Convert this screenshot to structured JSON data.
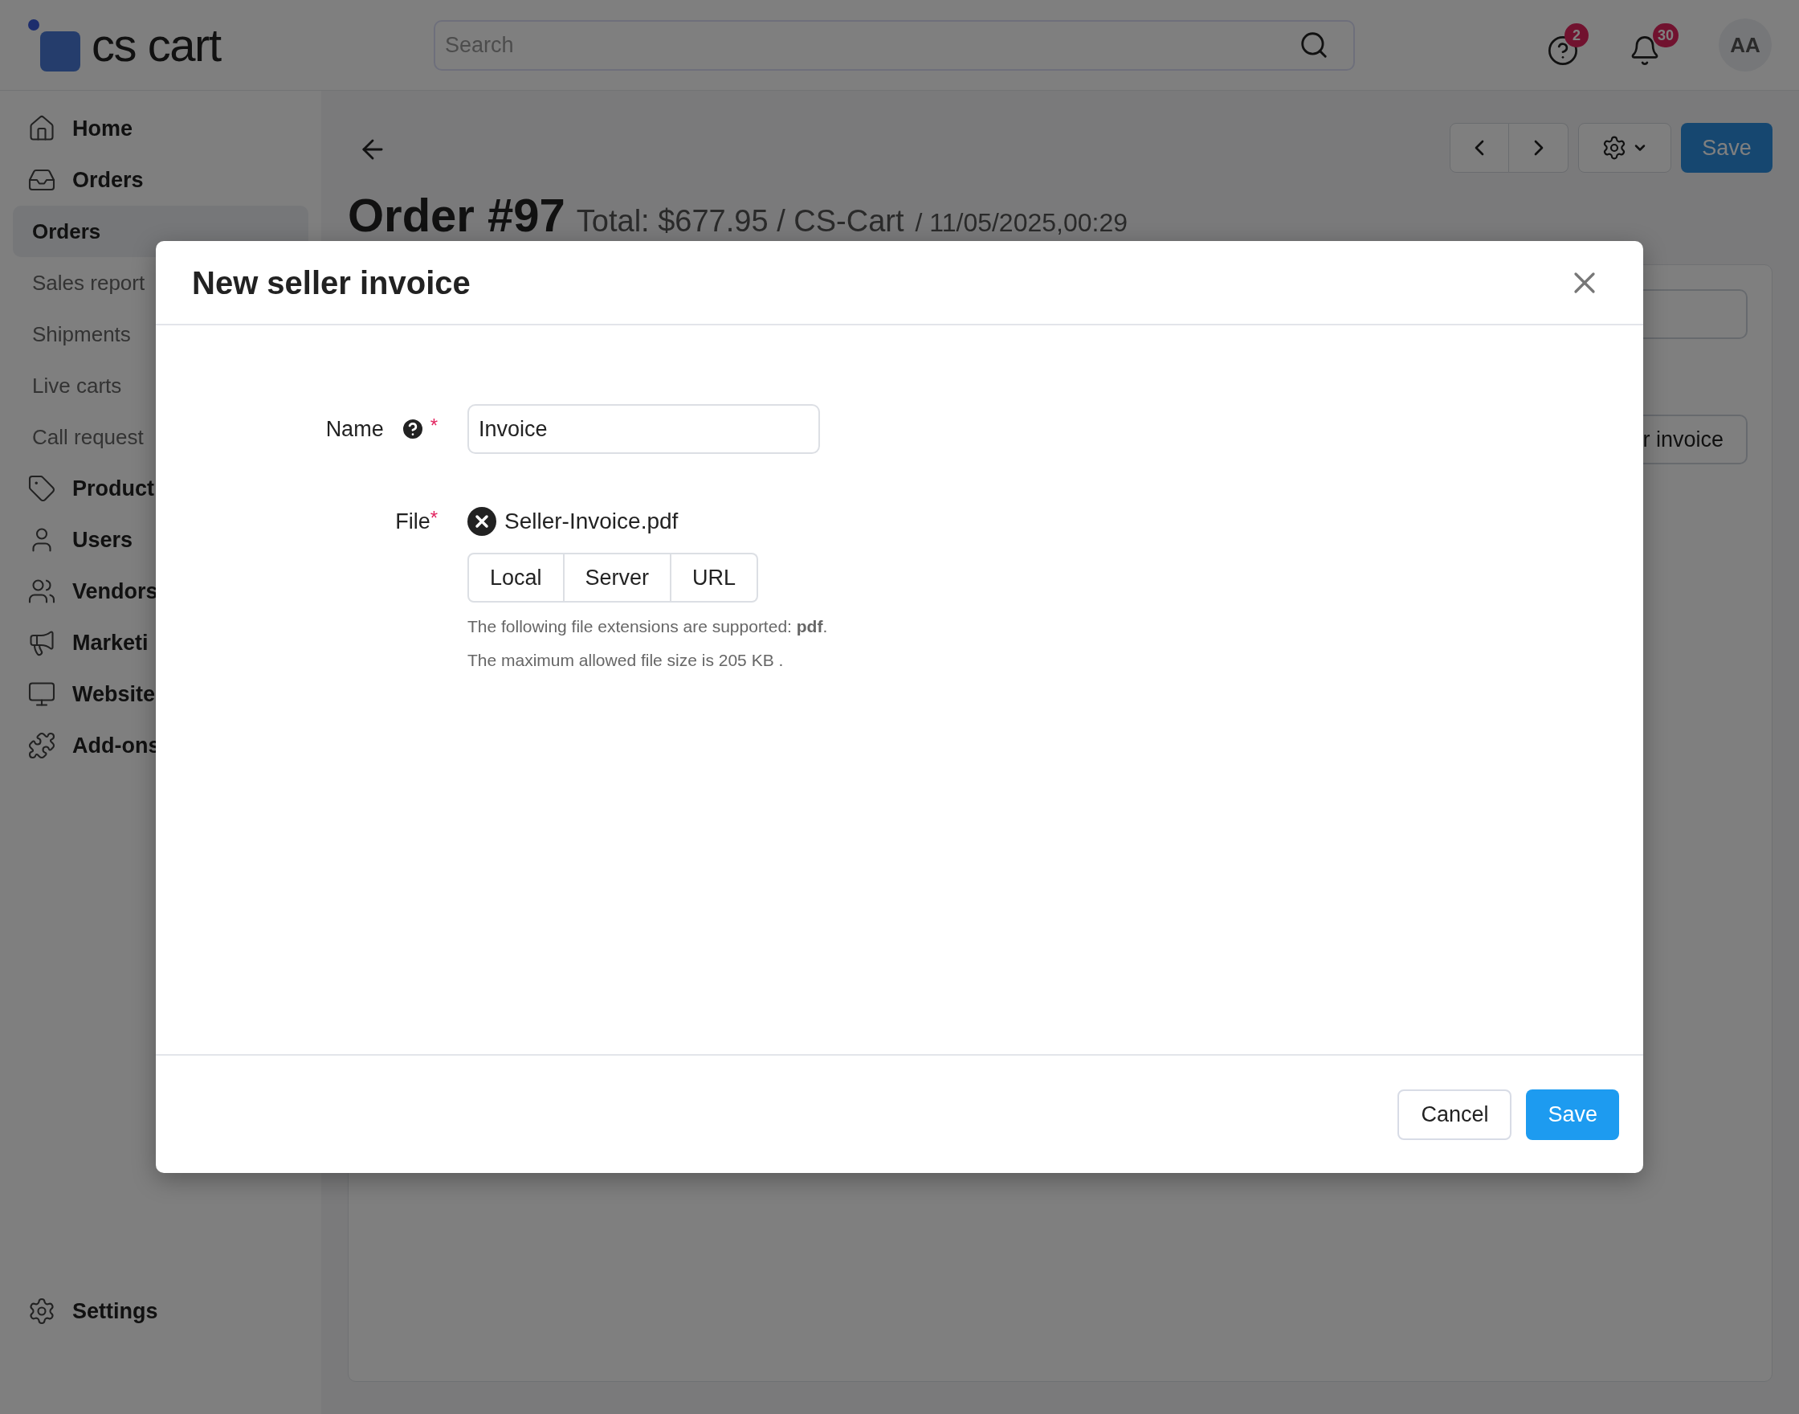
{
  "header": {
    "logo_text": "cs cart",
    "search": {
      "placeholder": "Search"
    },
    "help_badge": "2",
    "notifications_badge": "30",
    "avatar": "AA"
  },
  "sidebar": {
    "items": [
      {
        "kind": "section",
        "label": "Home"
      },
      {
        "kind": "section",
        "label": "Orders"
      },
      {
        "kind": "sub",
        "label": "Orders",
        "selected": true
      },
      {
        "kind": "sub",
        "label": "Sales report",
        "selected": false
      },
      {
        "kind": "sub",
        "label": "Shipments",
        "selected": false
      },
      {
        "kind": "sub",
        "label": "Live carts",
        "selected": false
      },
      {
        "kind": "sub",
        "label": "Call request",
        "selected": false
      },
      {
        "kind": "section",
        "label": "Product"
      },
      {
        "kind": "section",
        "label": "Users"
      },
      {
        "kind": "section",
        "label": "Vendors"
      },
      {
        "kind": "section",
        "label": "Marketi"
      },
      {
        "kind": "section",
        "label": "Website"
      },
      {
        "kind": "section",
        "label": "Add-ons"
      }
    ],
    "settings": "Settings"
  },
  "page": {
    "title": "Order #97",
    "total": "Total: $677.95 / CS-Cart",
    "date": "/ 11/05/2025,00:29",
    "save": "Save",
    "card_button": "r invoice"
  },
  "modal": {
    "title": "New seller invoice",
    "name_field": {
      "label": "Name",
      "help": true,
      "required_mark": "*",
      "value": "Invoice"
    },
    "file_field": {
      "label": "File",
      "required_mark": "*",
      "file_name": "Seller-Invoice.pdf",
      "sources": [
        "Local",
        "Server",
        "URL"
      ],
      "notes": [
        "The following file extensions are supported: **pdf**.",
        "The maximum allowed file size is 205 KB ."
      ]
    },
    "cancel": "Cancel",
    "save": "Save"
  }
}
